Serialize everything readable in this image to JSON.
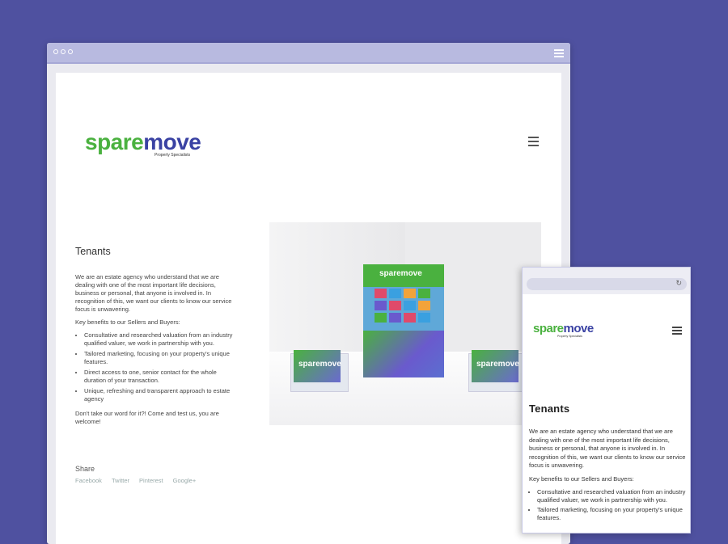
{
  "brand": {
    "part1": "spare",
    "part2": "move",
    "tagline": "Property Specialists",
    "green": "#4ab13f",
    "blue": "#3a42a3"
  },
  "desktop": {
    "window_icons": {
      "dots": "window-dots-icon",
      "menu": "menu-icon"
    },
    "page_title": "Tenants",
    "intro": "We are an estate agency who understand that we are dealing with one of the most important life decisions, business or personal, that anyone is involved in. In recognition of this, we want our clients to know our service focus is unwavering.",
    "benefits_heading": "Key benefits to our Sellers and Buyers:",
    "benefits": [
      "Consultative and researched valuation from an industry qualified valuer, we work in partnership with you.",
      "Tailored marketing, focusing on your property's unique features.",
      "Direct access to one, senior contact for the whole duration of your transaction.",
      "Unique, refreshing and transparent approach to estate agency"
    ],
    "closing": "Don't take our word for it?! Come and test us, you are welcome!",
    "share": {
      "title": "Share",
      "links": [
        "Facebook",
        "Twitter",
        "Pinterest",
        "Google+"
      ]
    },
    "photo": {
      "brochure_title": "sparemove",
      "card_label": "sparemove"
    }
  },
  "mobile": {
    "page_title": "Tenants",
    "intro": "We are an estate agency who understand that we are dealing with one of the most important life decisions, business or personal, that anyone is involved in. In recognition of this, we want our clients to know our service focus is unwavering.",
    "benefits_heading": "Key benefits to our Sellers and Buyers:",
    "benefits": [
      "Consultative and researched valuation from an industry qualified valuer, we work in partnership with you.",
      "Tailored marketing, focusing on your property's unique features."
    ],
    "reload_icon": "reload-icon"
  }
}
